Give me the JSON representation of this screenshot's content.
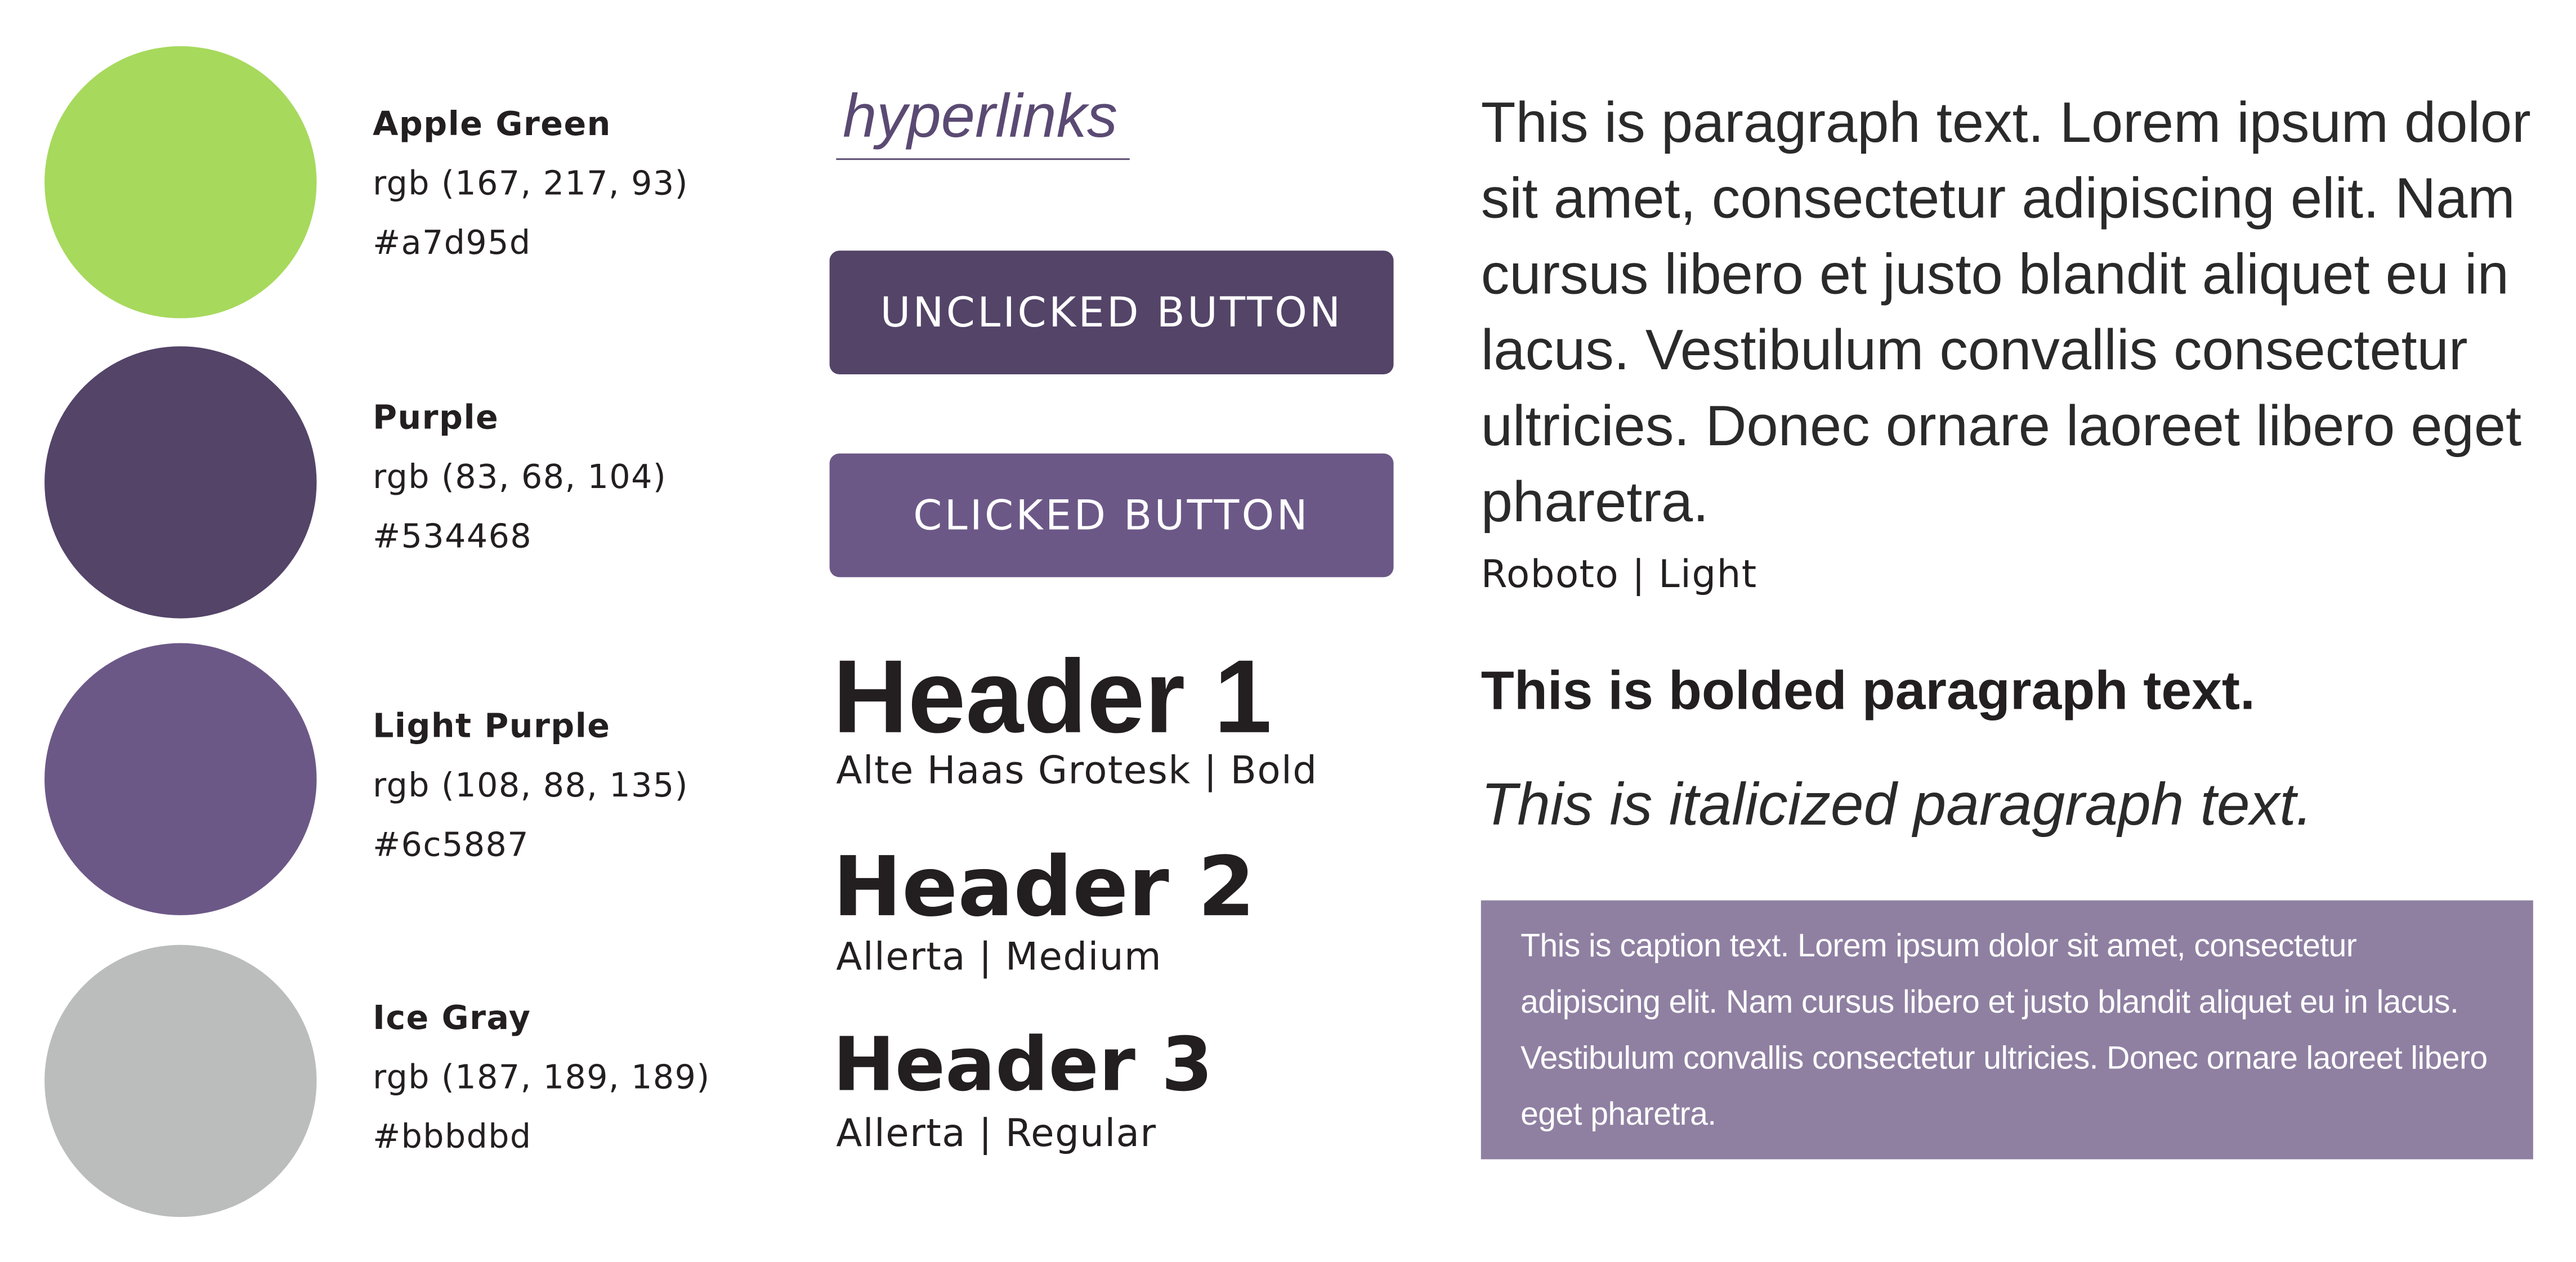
{
  "colors": [
    {
      "name": "Apple Green",
      "rgb": "rgb (167, 217, 93)",
      "hex": "#a7d95d"
    },
    {
      "name": "Purple",
      "rgb": "rgb (83, 68, 104)",
      "hex": "#534468"
    },
    {
      "name": "Light Purple",
      "rgb": "rgb (108, 88, 135)",
      "hex": "#6c5887"
    },
    {
      "name": "Ice Gray",
      "rgb": "rgb (187, 189, 189)",
      "hex": "#bbbdbd"
    }
  ],
  "hyperlink": "hyperlinks",
  "buttons": {
    "unclicked": "UNCLICKED BUTTON",
    "clicked": "CLICKED BUTTON"
  },
  "headers": [
    {
      "text": "Header 1",
      "label": "Alte Haas Grotesk | Bold"
    },
    {
      "text": "Header 2",
      "label": "Allerta | Medium"
    },
    {
      "text": "Header 3",
      "label": "Allerta | Regular"
    }
  ],
  "paragraph": {
    "text": "This is paragraph text. Lorem ipsum dolor sit amet, consectetur adipiscing elit. Nam cursus libero et justo blandit aliquet eu in lacus. Vestibulum convallis consectetur ultricies. Donec ornare laoreet libero eget pharetra.",
    "label": "Roboto | Light",
    "bold": "This is bolded paragraph text.",
    "italic": "This is italicized paragraph text."
  },
  "caption": "This is caption text. Lorem ipsum dolor sit amet, consectetur adipiscing elit. Nam cursus libero et justo blandit aliquet eu in lacus. Vestibulum convallis consectetur ultricies. Donec ornare laoreet libero eget pharetra.",
  "caption_bg": "#8f80a2"
}
